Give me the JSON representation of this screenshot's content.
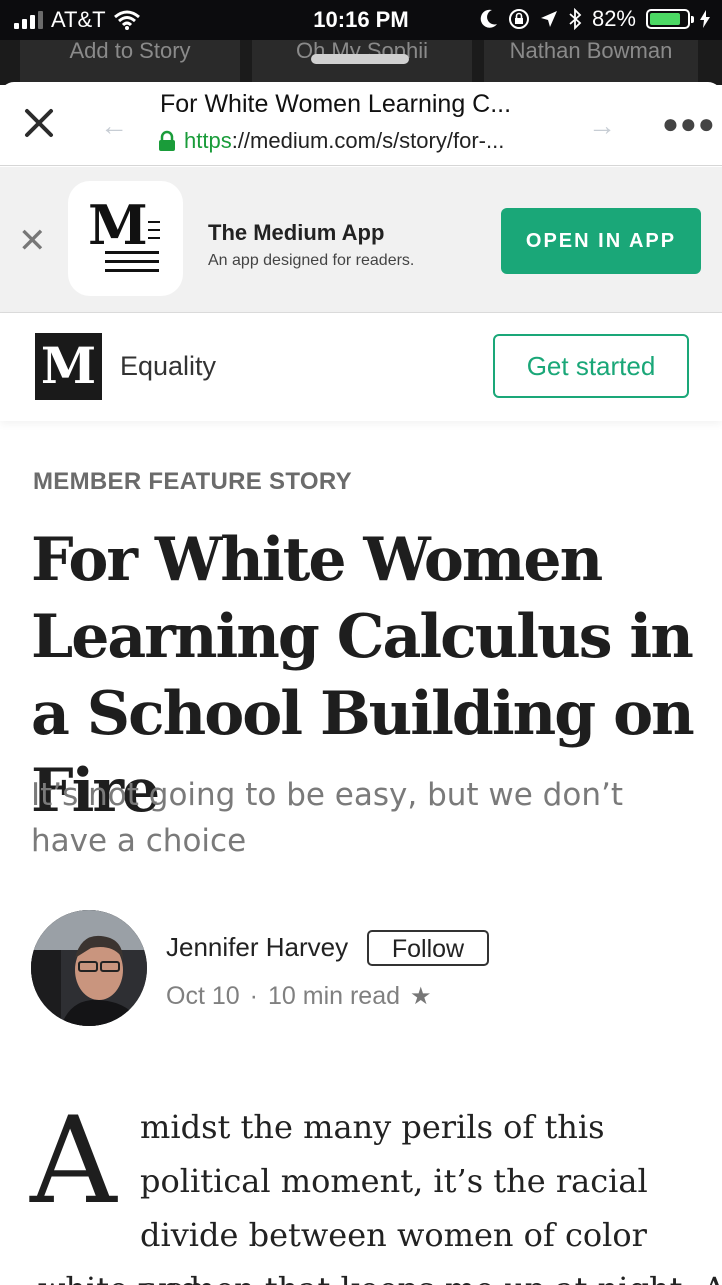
{
  "status_bar": {
    "carrier": "AT&T",
    "time": "10:16 PM",
    "battery": "82%",
    "battery_level": 0.82
  },
  "background_tabs": [
    "Add to Story",
    "Oh My Sophii",
    "Nathan Bowman"
  ],
  "browser": {
    "page_title": "For White Women Learning C...",
    "url_scheme": "https",
    "url_rest": "://medium.com/s/story/for-..."
  },
  "app_banner": {
    "app_name": "The Medium App",
    "app_description": "An app designed for readers.",
    "open_button": "OPEN IN APP"
  },
  "publication": {
    "logo_letter": "M",
    "name": "Equality",
    "cta": "Get started"
  },
  "article": {
    "kicker": "MEMBER FEATURE STORY",
    "title": "For White Women Learning Calculus in a School Building on Fire",
    "subtitle": "It’s not going to be easy, but we don’t have a choice",
    "author": "Jennifer Harvey",
    "follow": "Follow",
    "date": "Oct 10",
    "read_time": "10 min read",
    "drop_cap": "A",
    "body_lead": "midst the many perils of this political moment, it’s the racial divide between women of color and",
    "body_next": "white women that keeps me up at night. A"
  },
  "colors": {
    "accent": "#1aa778",
    "secure": "#1a9c3a",
    "status_bg": "#0c0c0e"
  }
}
